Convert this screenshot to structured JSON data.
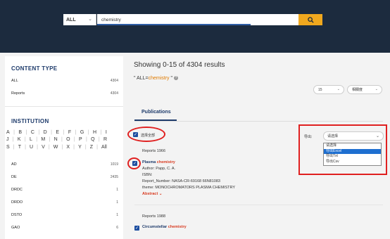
{
  "header": {
    "search_scope": "ALL",
    "search_value": "chemistry",
    "search_button_icon": "search-icon"
  },
  "sidebar": {
    "content_type_title": "CONTENT TYPE",
    "content_types": [
      {
        "label": "ALL",
        "count": "4304"
      },
      {
        "label": "Reports",
        "count": "4304"
      }
    ],
    "institution_title": "INSTITUTION",
    "alphabet_rows": [
      [
        "A",
        "B",
        "C",
        "D",
        "E",
        "F",
        "G",
        "H",
        "I"
      ],
      [
        "J",
        "K",
        "L",
        "M",
        "N",
        "O",
        "P",
        "Q",
        "R"
      ],
      [
        "S",
        "T",
        "U",
        "V",
        "W",
        "X",
        "Y",
        "Z",
        "All"
      ]
    ],
    "institutions": [
      {
        "label": "AD",
        "count": "1019"
      },
      {
        "label": "DE",
        "count": "2435"
      },
      {
        "label": "DRDC",
        "count": "1"
      },
      {
        "label": "DRDO",
        "count": "1"
      },
      {
        "label": "DSTO",
        "count": "1"
      },
      {
        "label": "GAO",
        "count": "6"
      }
    ]
  },
  "main": {
    "results_count": "Showing 0-15 of 4304 results",
    "query_prefix": "\" ALL=",
    "query_keyword": "chemistry",
    "query_suffix": " \"",
    "page_size": "15",
    "sort_by": "相關度",
    "tab_publications": "Publications",
    "select_all_label": "选择全部",
    "export_label": "导出:",
    "export_selected": "请选择",
    "export_options": [
      "请选择",
      "导出Excel",
      "导出Txt",
      "导出Csv"
    ],
    "results": [
      {
        "type_year": "Reports    1966",
        "title_prefix": "Plasma ",
        "title_highlight": "chemistry",
        "author": "Author:   Papp, C. A.",
        "isbn": "ISBN:",
        "report_number": "Report_Number:   NASA-CR-69168 66N81083",
        "theme": "theme:   MONOCHROMATORS PLASMA CHEMISTRY",
        "abstract_label": "Abstract"
      },
      {
        "type_year": "Reports    1988",
        "title_prefix": "Circumstellar ",
        "title_highlight": "chemistry"
      }
    ]
  }
}
